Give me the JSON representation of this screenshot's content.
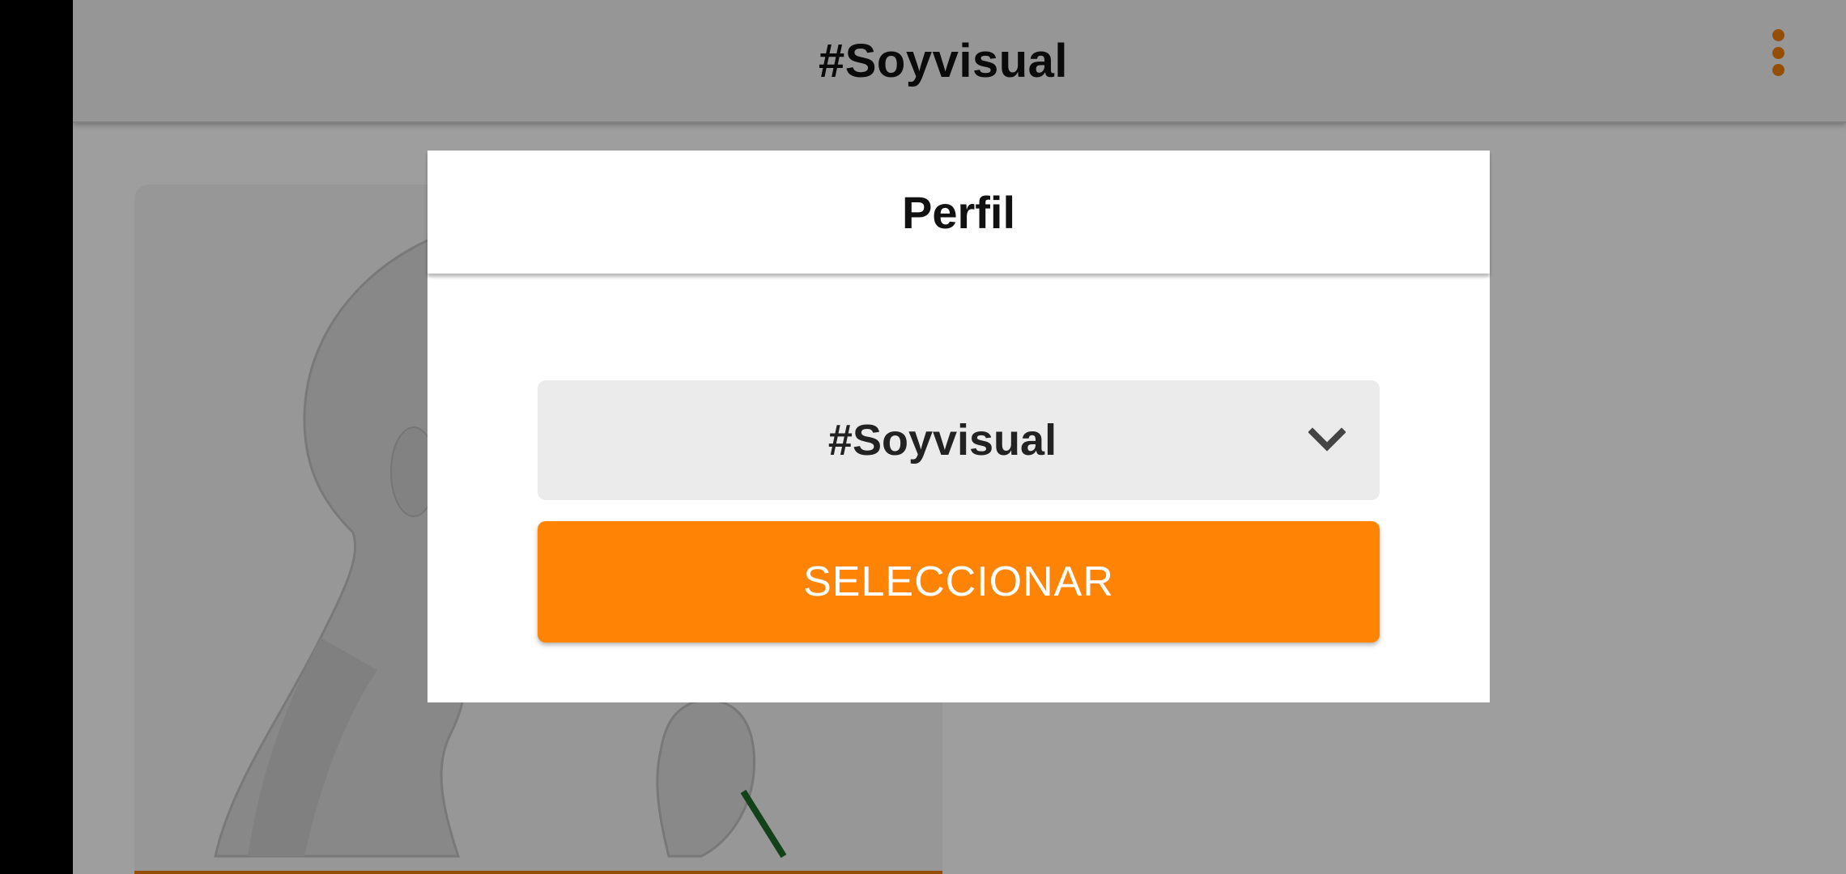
{
  "appbar": {
    "title": "#Soyvisual",
    "menu_icon": "more-vert-icon",
    "accent_color": "#f07f0c"
  },
  "background_card": {
    "image": "illustration-person-holding-flower"
  },
  "dialog": {
    "title": "Perfil",
    "select": {
      "value": "#Soyvisual",
      "icon": "chevron-down-icon"
    },
    "button": {
      "label": "SELECCIONAR",
      "color": "#ff8304"
    }
  }
}
